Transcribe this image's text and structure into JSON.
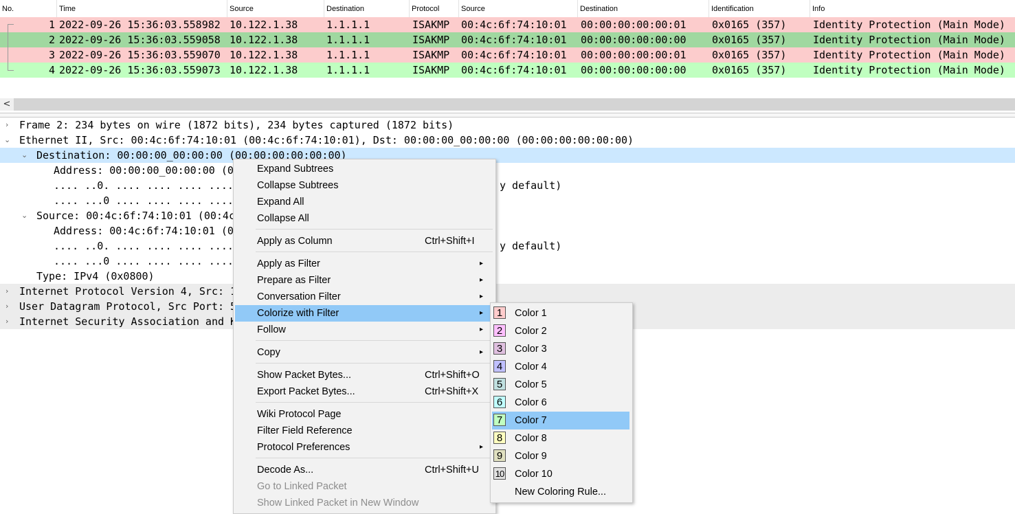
{
  "packet_list": {
    "columns": [
      "No.",
      "Time",
      "Source",
      "Destination",
      "Protocol",
      "Source",
      "Destination",
      "Identification",
      "Info"
    ],
    "rows": [
      {
        "no": "1",
        "time": "2022-09-26 15:36:03.558982",
        "src": "10.122.1.38",
        "dst": "1.1.1.1",
        "proto": "ISAKMP",
        "hwsrc": "00:4c:6f:74:10:01",
        "hwdst": "00:00:00:00:00:01",
        "ident": "0x0165 (357)",
        "info": "Identity Protection (Main Mode)",
        "color": "#fccccc"
      },
      {
        "no": "2",
        "time": "2022-09-26 15:36:03.559058",
        "src": "10.122.1.38",
        "dst": "1.1.1.1",
        "proto": "ISAKMP",
        "hwsrc": "00:4c:6f:74:10:01",
        "hwdst": "00:00:00:00:00:00",
        "ident": "0x0165 (357)",
        "info": "Identity Protection (Main Mode)",
        "color": "#a0d8a0"
      },
      {
        "no": "3",
        "time": "2022-09-26 15:36:03.559070",
        "src": "10.122.1.38",
        "dst": "1.1.1.1",
        "proto": "ISAKMP",
        "hwsrc": "00:4c:6f:74:10:01",
        "hwdst": "00:00:00:00:00:01",
        "ident": "0x0165 (357)",
        "info": "Identity Protection (Main Mode)",
        "color": "#fccccc"
      },
      {
        "no": "4",
        "time": "2022-09-26 15:36:03.559073",
        "src": "10.122.1.38",
        "dst": "1.1.1.1",
        "proto": "ISAKMP",
        "hwsrc": "00:4c:6f:74:10:01",
        "hwdst": "00:00:00:00:00:00",
        "ident": "0x0165 (357)",
        "info": "Identity Protection (Main Mode)",
        "color": "#c0ffc0"
      }
    ]
  },
  "scrollbar": {
    "left_arrow": "<"
  },
  "details": {
    "frame": "Frame 2: 234 bytes on wire (1872 bits), 234 bytes captured (1872 bits)",
    "ethernet": "Ethernet II, Src: 00:4c:6f:74:10:01 (00:4c:6f:74:10:01), Dst: 00:00:00_00:00:00 (00:00:00:00:00:00)",
    "destination": "Destination: 00:00:00_00:00:00 (00:00:00:00:00:00)",
    "dst_address": "Address: 00:00:00_00:00:00 (0",
    "dst_lg": ".... ..0. .... .... .... ....",
    "dst_lg_tail": "y default)",
    "dst_ig": ".... ...0 .... .... .... ....",
    "source": "Source: 00:4c:6f:74:10:01 (00:4c",
    "src_address": "Address: 00:4c:6f:74:10:01 (0",
    "src_lg": ".... ..0. .... .... .... ....",
    "src_lg_tail": "y default)",
    "src_ig": ".... ...0 .... .... .... ....",
    "type": "Type: IPv4 (0x0800)",
    "ip": "Internet Protocol Version 4, Src: 1",
    "udp": "User Datagram Protocol, Src Port: 5",
    "isakmp": "Internet Security Association and K"
  },
  "context_menu": {
    "expand_subtrees": "Expand Subtrees",
    "collapse_subtrees": "Collapse Subtrees",
    "expand_all": "Expand All",
    "collapse_all": "Collapse All",
    "apply_as_column": "Apply as Column",
    "apply_as_column_sc": "Ctrl+Shift+I",
    "apply_as_filter": "Apply as Filter",
    "prepare_as_filter": "Prepare as Filter",
    "conversation_filter": "Conversation Filter",
    "colorize_with_filter": "Colorize with Filter",
    "follow": "Follow",
    "copy": "Copy",
    "show_packet_bytes": "Show Packet Bytes...",
    "show_packet_bytes_sc": "Ctrl+Shift+O",
    "export_packet_bytes": "Export Packet Bytes...",
    "export_packet_bytes_sc": "Ctrl+Shift+X",
    "wiki_protocol_page": "Wiki Protocol Page",
    "filter_field_reference": "Filter Field Reference",
    "protocol_preferences": "Protocol Preferences",
    "decode_as": "Decode As...",
    "decode_as_sc": "Ctrl+Shift+U",
    "go_to_linked_packet": "Go to Linked Packet",
    "show_linked_packet": "Show Linked Packet in New Window"
  },
  "colorize_submenu": {
    "items": [
      {
        "num": "1",
        "label": "Color 1",
        "swatch": "#ffcccc"
      },
      {
        "num": "2",
        "label": "Color 2",
        "swatch": "#ffc0ff"
      },
      {
        "num": "3",
        "label": "Color 3",
        "swatch": "#e0c0e0"
      },
      {
        "num": "4",
        "label": "Color 4",
        "swatch": "#c0c0ff"
      },
      {
        "num": "5",
        "label": "Color 5",
        "swatch": "#c0e0e0"
      },
      {
        "num": "6",
        "label": "Color 6",
        "swatch": "#c0ffff"
      },
      {
        "num": "7",
        "label": "Color 7",
        "swatch": "#c0ffc0"
      },
      {
        "num": "8",
        "label": "Color 8",
        "swatch": "#ffffc0"
      },
      {
        "num": "9",
        "label": "Color 9",
        "swatch": "#e0e0c0"
      },
      {
        "num": "10",
        "label": "Color 10",
        "swatch": "#e0e0e0"
      }
    ],
    "new_rule": "New Coloring Rule..."
  }
}
